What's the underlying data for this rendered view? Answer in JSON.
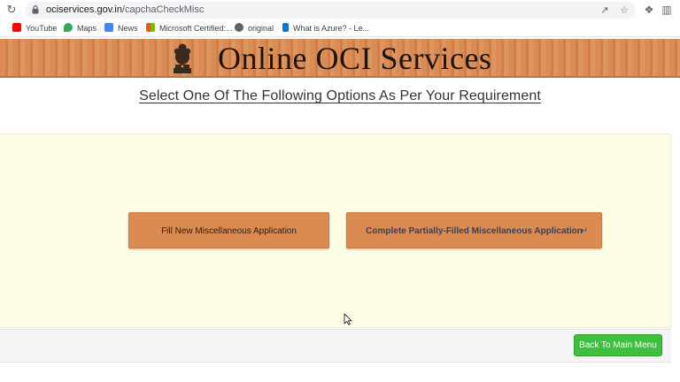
{
  "browser": {
    "url_host": "ociservices.gov.in",
    "url_path": "/capchaCheckMisc",
    "bookmarks": [
      {
        "label": "YouTube",
        "icon": "youtube-icon",
        "color": "#ff0000"
      },
      {
        "label": "Maps",
        "icon": "maps-icon",
        "color": "#34a853"
      },
      {
        "label": "News",
        "icon": "news-icon",
        "color": "#4285f4"
      },
      {
        "label": "Microsoft Certified:...",
        "icon": "microsoft-icon",
        "color": "#f25022"
      },
      {
        "label": "original",
        "icon": "globe-icon",
        "color": "#5f6368"
      },
      {
        "label": "What is Azure? - Le...",
        "icon": "azure-icon",
        "color": "#0078d4"
      }
    ]
  },
  "page": {
    "banner_title": "Online OCI Services",
    "heading": "Select One Of The Following Options As Per Your Requirement",
    "options": [
      {
        "label": "Fill New Miscellaneous Application"
      },
      {
        "label": "Complete Partially-Filled Miscellaneous Application"
      }
    ],
    "back_button": "Back To Main Menu"
  },
  "colors": {
    "banner": "#d98c54",
    "panel": "#fdfde3",
    "option_button": "#d98b52",
    "back_button": "#3fbf3f"
  }
}
